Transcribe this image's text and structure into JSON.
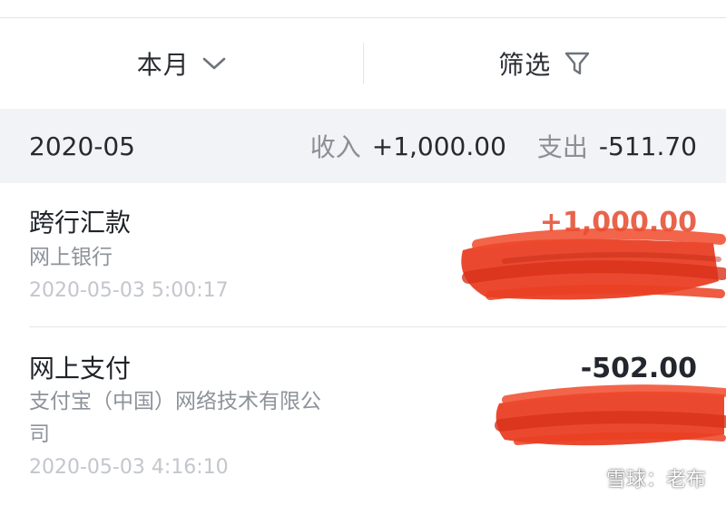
{
  "filter_bar": {
    "period_label": "本月",
    "filter_label": "筛选"
  },
  "summary": {
    "month": "2020-05",
    "income_label": "收入",
    "income_value": "+1,000.00",
    "expense_label": "支出",
    "expense_value": "-511.70"
  },
  "transactions": [
    {
      "title": "跨行汇款",
      "counterparty": "网上银行",
      "time": "2020-05-03 5:00:17",
      "amount": "+1,000.00",
      "direction": "income"
    },
    {
      "title": "网上支付",
      "counterparty_line1": "支付宝（中国）网络技术有限公",
      "counterparty_line2": "司",
      "time": "2020-05-03 4:16:10",
      "amount": "-502.00",
      "direction": "expense"
    }
  ],
  "watermark": {
    "text": "雪球：老布"
  },
  "colors": {
    "income_amount": "#e8644c",
    "expense_amount": "#23272d",
    "summary_background": "#f2f3f6",
    "redaction_scribble": "#e8391e"
  },
  "icons": {
    "period_dropdown": "chevron-down-icon",
    "filter": "funnel-icon"
  }
}
